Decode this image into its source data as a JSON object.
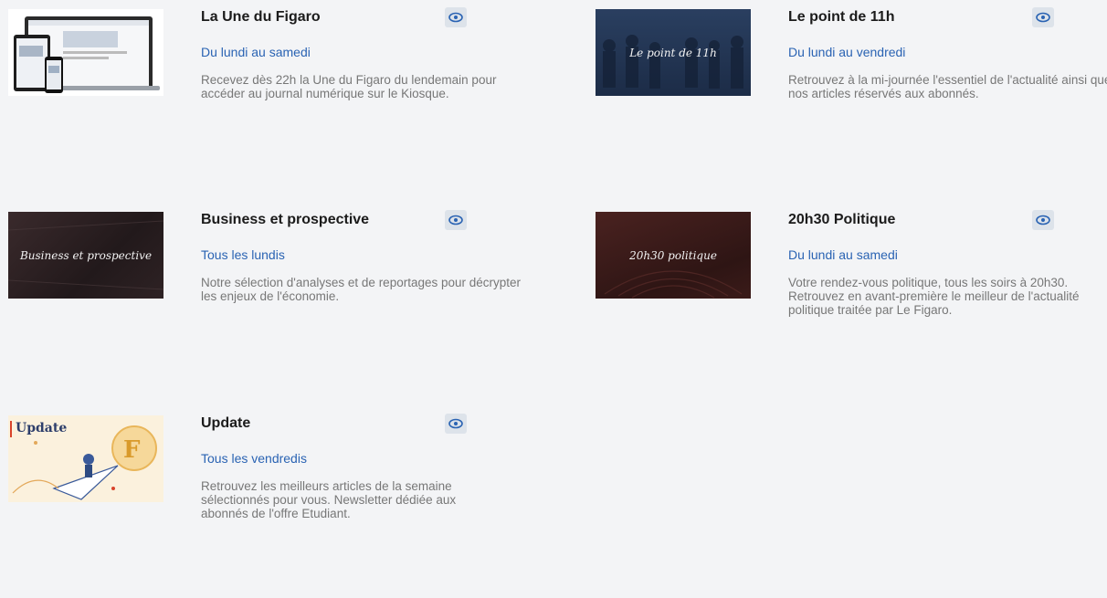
{
  "accent_link": "#2a63b3",
  "eye_icon": "eye-icon",
  "newsletters": [
    {
      "title": "La Une du Figaro",
      "frequency": "Du lundi au samedi",
      "description": "Recevez dès 22h la Une du Figaro du lendemain pour accéder au journal numérique sur le Kiosque.",
      "thumb_label": ""
    },
    {
      "title": "Le point de 11h",
      "frequency": "Du lundi au vendredi",
      "description": "Retrouvez à la mi-journée l'essentiel de l'actualité ainsi que nos articles réservés aux abonnés.",
      "thumb_label": "Le point de 11h"
    },
    {
      "title": "Business et prospective",
      "frequency": "Tous les lundis",
      "description": "Notre sélection d'analyses et de reportages pour décrypter les enjeux de l'économie.",
      "thumb_label": "Business et prospective"
    },
    {
      "title": "20h30 Politique",
      "frequency": "Du lundi au samedi",
      "description": "Votre rendez-vous politique, tous les soirs à 20h30. Retrouvez en avant-première le meilleur de l'actualité politique traitée par Le Figaro.",
      "thumb_label": "20h30 politique"
    },
    {
      "title": "Update",
      "frequency": "Tous les vendredis",
      "description": "Retrouvez les meilleurs articles de la semaine sélectionnés pour vous. Newsletter dédiée aux abonnés de l'offre Etudiant.",
      "thumb_label": "Update"
    }
  ]
}
